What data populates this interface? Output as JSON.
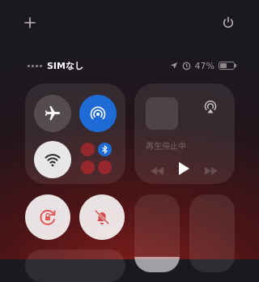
{
  "status": {
    "carrier": "SIMなし",
    "battery": "47%",
    "battery_level": 0.47
  },
  "now_playing": {
    "label": "再生停止中"
  },
  "icons": {
    "add": "plus-icon",
    "power": "power-icon",
    "airplane": "airplane-icon",
    "airdrop": "airdrop-icon",
    "wifi": "wifi-icon",
    "bluetooth": "bluetooth-icon",
    "airplay": "airplay-icon",
    "rotation_lock": "rotation-lock-icon",
    "silent": "bell-slash-icon"
  },
  "colors": {
    "active_blue": "#1f6bd6",
    "wifi_active": "#e9e6e8",
    "rotation_active": "#e05a5a"
  },
  "sliders": {
    "brightness_level": 0.2,
    "volume_level": 0.0
  }
}
